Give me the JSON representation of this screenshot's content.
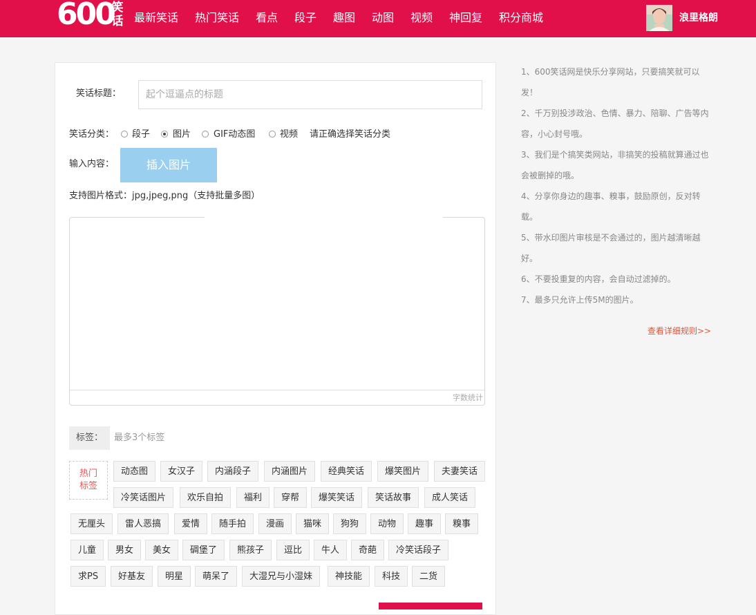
{
  "header": {
    "logo_number": "600",
    "logo_text": "笑话",
    "nav": [
      "最新笑话",
      "热门笑话",
      "看点",
      "段子",
      "趣图",
      "动图",
      "视频",
      "神回复",
      "积分商城"
    ],
    "username": "浪里格朗"
  },
  "form": {
    "title_label": "笑话标题：",
    "title_placeholder": "起个逗逼点的标题",
    "category_label": "笑话分类：",
    "categories": [
      {
        "label": "段子",
        "selected": false
      },
      {
        "label": "图片",
        "selected": true
      },
      {
        "label": "GIF动态图",
        "selected": false
      },
      {
        "label": "视频",
        "selected": false
      }
    ],
    "category_hint": "请正确选择笑话分类",
    "content_label": "输入内容：",
    "insert_image_button": "插入图片",
    "format_note": "支持图片格式：jpg,jpeg,png（支持批量多图）",
    "word_count": "字数统计",
    "tags_label": "标签：",
    "tags_placeholder": "最多3个标签",
    "hot_tags_label_line1": "热门",
    "hot_tags_label_line2": "标签",
    "hot_tags": [
      "动态图",
      "女汉子",
      "内涵段子",
      "内涵图片",
      "经典笑话",
      "爆笑图片",
      "夫妻笑话",
      "冷笑话图片",
      "欢乐自拍",
      "福利",
      "穿帮",
      "爆笑笑话",
      "笑话故事",
      "成人笑话",
      "无厘头",
      "雷人恶搞",
      "爱情",
      "随手拍",
      "漫画",
      "猫咪",
      "狗狗",
      "动物",
      "趣事",
      "糗事",
      "儿童",
      "男女",
      "美女",
      "碉堡了",
      "熊孩子",
      "逗比",
      "牛人",
      "奇葩",
      "冷笑话段子",
      "求PS",
      "好基友",
      "明星",
      "萌呆了",
      "大湿兄与小湿妹",
      "神技能",
      "科技",
      "二货"
    ]
  },
  "sidebar": {
    "rules": [
      "1、600笑话网是快乐分享网站，只要搞笑就可以发！",
      "2、千万别投涉政治、色情、暴力、陪聊、广告等内容，小心封号哦。",
      "3、我们是个搞笑类网站，非搞笑的投稿就算通过也会被删掉的哦。",
      "4、分享你身边的趣事、糗事，鼓励原创，反对转载。",
      "5、带水印图片审核是不会通过的，图片越清晰越好。",
      "6、不要投重复的内容，会自动过滤掉的。",
      "7、最多只允许上传5M的图片。"
    ],
    "detail_link": "查看详细规则>>"
  },
  "colors": {
    "brand_red": "#e2104a",
    "insert_button": "#9bcfef",
    "link_orange": "#e0553a"
  }
}
